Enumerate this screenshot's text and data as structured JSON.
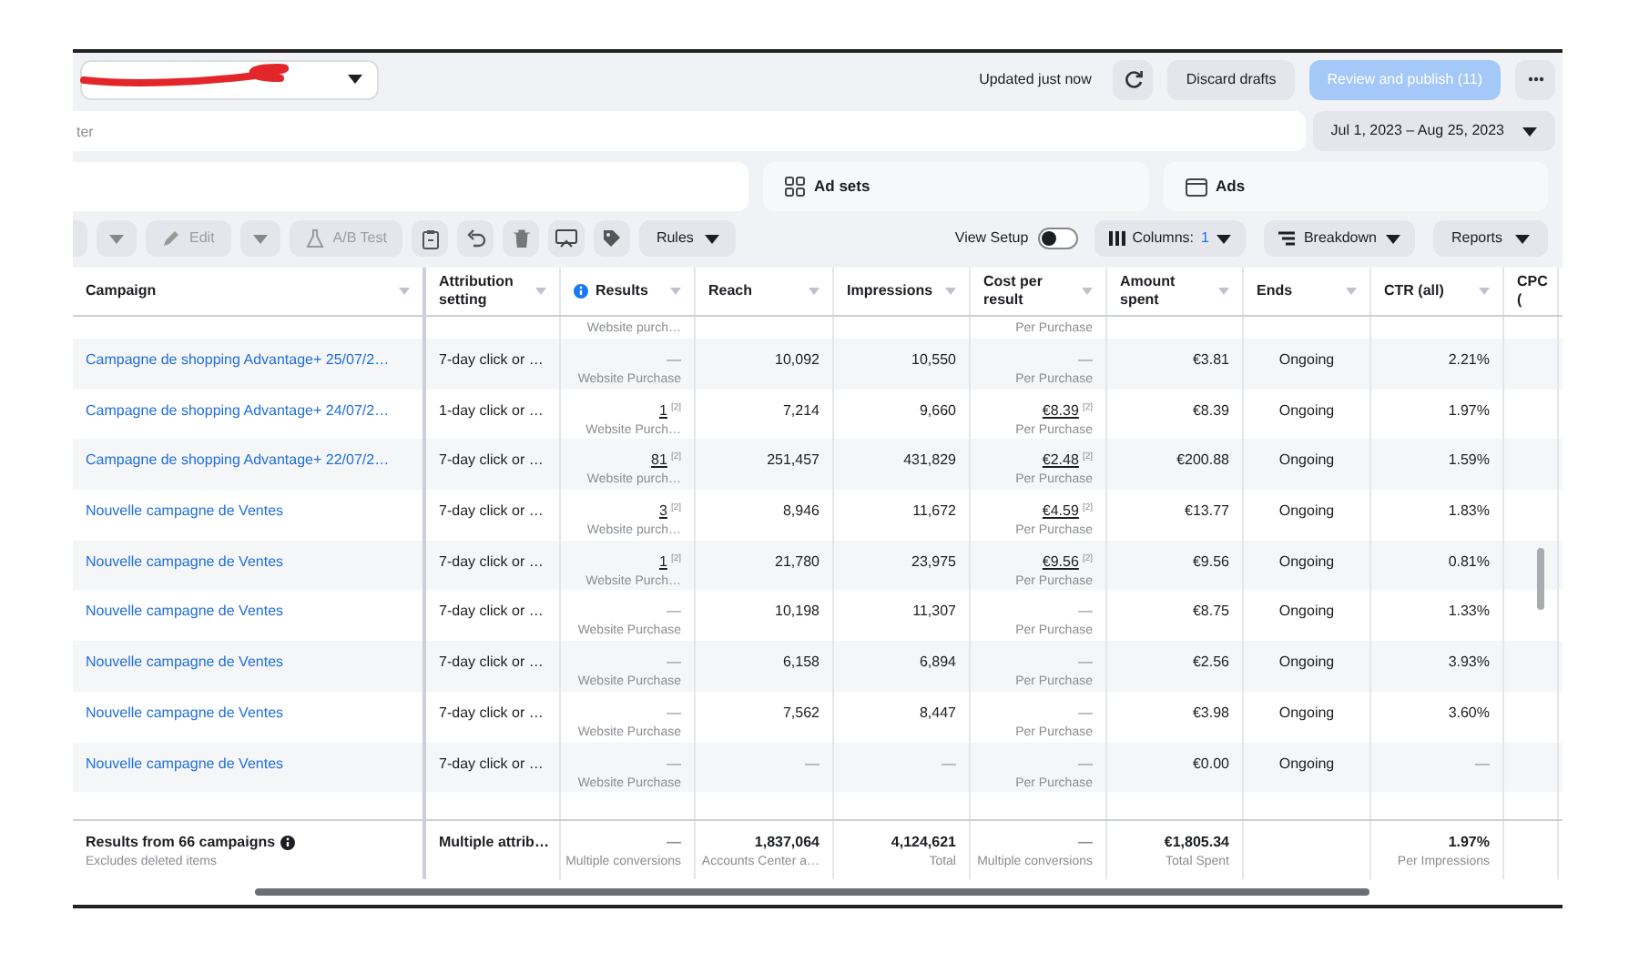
{
  "top_bar": {
    "status": "Updated just now",
    "buttons": [
      {
        "label": "Discard drafts",
        "kind": "secondary",
        "disabled": false
      },
      {
        "label": "Review and publish (11)",
        "kind": "primary",
        "disabled": true
      }
    ]
  },
  "search": {
    "placeholder": "ter"
  },
  "date_range": "Jul 1, 2023 – Aug 25, 2023",
  "tabs": [
    {
      "label": "Ad sets",
      "kind": "adsets",
      "selected": false
    },
    {
      "label": "Ads",
      "kind": "ads",
      "selected": false
    }
  ],
  "toolbar": {
    "buttons": [
      {
        "label": "Edit",
        "kind": "edit",
        "disabled": true
      },
      {
        "label": "A/B Test",
        "kind": "abtest",
        "disabled": true
      }
    ],
    "rules": "Rules",
    "view_setup": {
      "label": "View Setup",
      "on": false
    },
    "columns": {
      "label": "Columns:",
      "count": "1"
    },
    "breakdown": "Breakdown",
    "reports": "Reports"
  },
  "table": {
    "columns": [
      {
        "label": "Campaign"
      },
      {
        "label": "Attribution setting"
      },
      {
        "label": "Results",
        "info": true
      },
      {
        "label": "Reach"
      },
      {
        "label": "Impressions"
      },
      {
        "label": "Cost per result"
      },
      {
        "label": "Amount spent"
      },
      {
        "label": "Ends"
      },
      {
        "label": "CTR (all)"
      },
      {
        "label": "CPC ("
      }
    ],
    "rows": [
      {
        "kind": "partial",
        "results": {
          "label": "Website purch…"
        },
        "cost": {
          "label": "Per Purchase"
        }
      },
      {
        "kind": "full",
        "campaign": "Campagne de shopping Advantage+ 25/07/2…",
        "attribution": "7-day click or …",
        "results": {
          "value": "—",
          "label": "Website Purchase"
        },
        "reach": "10,092",
        "impressions": "10,550",
        "cost": {
          "value": "—",
          "label": "Per Purchase"
        },
        "amount_spent": "€3.81",
        "ends": "Ongoing",
        "ctr": "2.21%"
      },
      {
        "kind": "full",
        "campaign": "Campagne de shopping Advantage+ 24/07/2…",
        "attribution": "1-day click or …",
        "results": {
          "value": "1",
          "note": "[2]",
          "label": "Website Purch…"
        },
        "reach": "7,214",
        "impressions": "9,660",
        "cost": {
          "value": "€8.39",
          "note": "[2]",
          "label": "Per Purchase"
        },
        "amount_spent": "€8.39",
        "ends": "Ongoing",
        "ctr": "1.97%"
      },
      {
        "kind": "full",
        "campaign": "Campagne de shopping Advantage+ 22/07/2…",
        "attribution": "7-day click or …",
        "results": {
          "value": "81",
          "note": "[2]",
          "label": "Website purch…"
        },
        "reach": "251,457",
        "impressions": "431,829",
        "cost": {
          "value": "€2.48",
          "note": "[2]",
          "label": "Per Purchase"
        },
        "amount_spent": "€200.88",
        "ends": "Ongoing",
        "ctr": "1.59%"
      },
      {
        "kind": "full",
        "campaign": "Nouvelle campagne de Ventes",
        "attribution": "7-day click or …",
        "results": {
          "value": "3",
          "note": "[2]",
          "label": "Website purch…"
        },
        "reach": "8,946",
        "impressions": "11,672",
        "cost": {
          "value": "€4.59",
          "note": "[2]",
          "label": "Per Purchase"
        },
        "amount_spent": "€13.77",
        "ends": "Ongoing",
        "ctr": "1.83%"
      },
      {
        "kind": "full",
        "campaign": "Nouvelle campagne de Ventes",
        "attribution": "7-day click or …",
        "results": {
          "value": "1",
          "note": "[2]",
          "label": "Website Purch…"
        },
        "reach": "21,780",
        "impressions": "23,975",
        "cost": {
          "value": "€9.56",
          "note": "[2]",
          "label": "Per Purchase"
        },
        "amount_spent": "€9.56",
        "ends": "Ongoing",
        "ctr": "0.81%"
      },
      {
        "kind": "full",
        "campaign": "Nouvelle campagne de Ventes",
        "attribution": "7-day click or …",
        "results": {
          "value": "—",
          "label": "Website Purchase"
        },
        "reach": "10,198",
        "impressions": "11,307",
        "cost": {
          "value": "—",
          "label": "Per Purchase"
        },
        "amount_spent": "€8.75",
        "ends": "Ongoing",
        "ctr": "1.33%"
      },
      {
        "kind": "full",
        "campaign": "Nouvelle campagne de Ventes",
        "attribution": "7-day click or …",
        "results": {
          "value": "—",
          "label": "Website Purchase"
        },
        "reach": "6,158",
        "impressions": "6,894",
        "cost": {
          "value": "—",
          "label": "Per Purchase"
        },
        "amount_spent": "€2.56",
        "ends": "Ongoing",
        "ctr": "3.93%"
      },
      {
        "kind": "full",
        "campaign": "Nouvelle campagne de Ventes",
        "attribution": "7-day click or …",
        "results": {
          "value": "—",
          "label": "Website Purchase"
        },
        "reach": "7,562",
        "impressions": "8,447",
        "cost": {
          "value": "—",
          "label": "Per Purchase"
        },
        "amount_spent": "€3.98",
        "ends": "Ongoing",
        "ctr": "3.60%"
      },
      {
        "kind": "full",
        "campaign": "Nouvelle campagne de Ventes",
        "attribution": "7-day click or …",
        "results": {
          "value": "—",
          "label": "Website Purchase"
        },
        "reach": "—",
        "impressions": "—",
        "cost": {
          "value": "—",
          "label": "Per Purchase"
        },
        "amount_spent": "€0.00",
        "ends": "Ongoing",
        "ctr": "—"
      }
    ],
    "footer": {
      "title": "Results from 66 campaigns",
      "subtitle": "Excludes deleted items",
      "attribution": {
        "value": "Multiple attrib…"
      },
      "results": {
        "value": "—",
        "label": "Multiple conversions"
      },
      "reach": {
        "value": "1,837,064",
        "label": "Accounts Center a…"
      },
      "impressions": {
        "value": "4,124,621",
        "label": "Total"
      },
      "cost": {
        "value": "—",
        "label": "Multiple conversions"
      },
      "amount_spent": {
        "value": "€1,805.34",
        "label": "Total Spent"
      },
      "ctr": {
        "value": "1.97%",
        "label": "Per Impressions"
      }
    }
  }
}
